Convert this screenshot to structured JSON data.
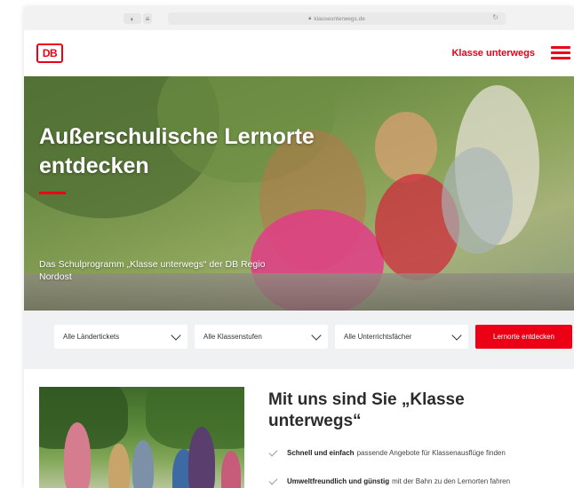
{
  "browser": {
    "url": "klasseunterwegs.de",
    "reload_glyph": "↻",
    "left_icons": [
      "sidebar-icon",
      "tabs-icon"
    ]
  },
  "header": {
    "logo_text": "DB",
    "title": "Klasse unterwegs",
    "menu_icon": "hamburger-menu-icon"
  },
  "hero": {
    "title_line1": "Außerschulische Lernorte",
    "title_line2": "entdecken",
    "subtitle_line1": "Das Schulprogramm „Klasse unterwegs“ der DB Regio",
    "subtitle_line2": "Nordost"
  },
  "filters": {
    "tickets": "Alle Ländertickets",
    "grades": "Alle Klassenstufen",
    "subjects": "Alle Unterrichtsfächer",
    "submit": "Lernorte entdecken"
  },
  "section": {
    "title_line1": "Mit uns sind Sie „Klasse",
    "title_line2": "unterwegs“",
    "bullets": [
      {
        "bold": "Schnell und einfach",
        "text": "passende Angebote für Klassenausflüge finden"
      },
      {
        "bold": "Umweltfreundlich und günstig",
        "text": "mit der Bahn zu den Lernorten fahren"
      }
    ]
  },
  "colors": {
    "brand_red": "#ec0016",
    "filter_bg": "#f0f1f2",
    "text_dark": "#2b2b2b"
  }
}
